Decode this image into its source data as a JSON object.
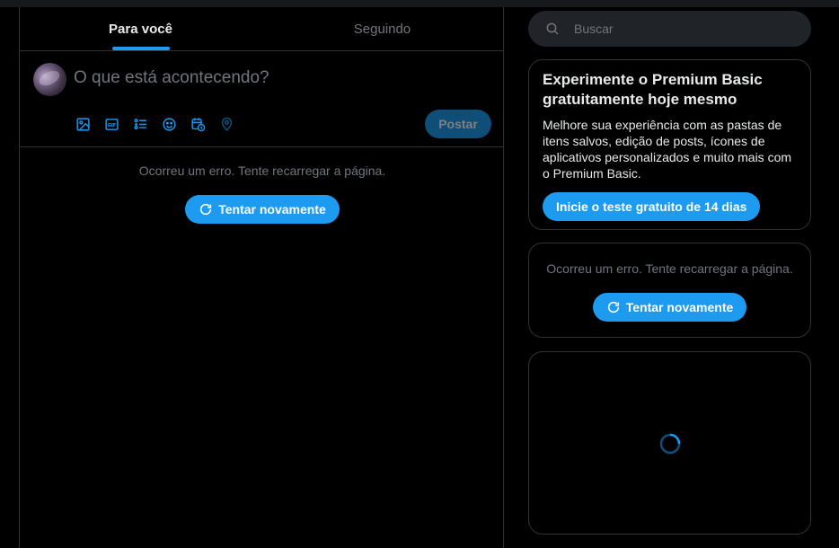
{
  "tabs": [
    {
      "label": "Para você",
      "active": true
    },
    {
      "label": "Seguindo",
      "active": false
    }
  ],
  "composer": {
    "placeholder": "O que está acontecendo?",
    "tools": [
      "image-icon",
      "gif-icon",
      "poll-icon",
      "emoji-icon",
      "schedule-icon",
      "location-icon"
    ],
    "post_label": "Postar"
  },
  "feed_error": {
    "message": "Ocorreu um erro. Tente recarregar a página.",
    "retry_label": "Tentar novamente"
  },
  "search": {
    "placeholder": "Buscar"
  },
  "premium": {
    "title": "Experimente o Premium Basic gratuitamente hoje mesmo",
    "body": "Melhore sua experiência com as pastas de itens salvos, edição de posts, ícones de aplicativos personalizados e muito mais com o Premium Basic.",
    "cta_label": "Inicie o teste gratuito de 14 dias"
  },
  "sidebar_error": {
    "message": "Ocorreu um erro. Tente recarregar a página.",
    "retry_label": "Tentar novamente"
  },
  "colors": {
    "accent": "#1d9bf0",
    "background": "#000000",
    "border": "#2f3336",
    "muted_text": "#71767b"
  }
}
